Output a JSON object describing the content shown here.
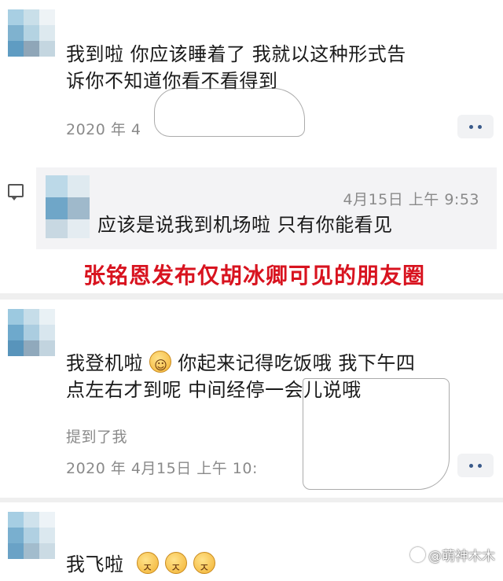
{
  "post1": {
    "text_line1": "我到啦 你应该睡着了 我就以这种形式告",
    "text_line2": "诉你不知道你看不看得到",
    "timestamp": "2020 年 4"
  },
  "comment": {
    "time": "4月15日 上午 9:53",
    "text": "应该是说我到机场啦 只有你能看见"
  },
  "caption": "张铭恩发布仅胡冰卿可见的朋友圈",
  "post2": {
    "text_line1_a": "我登机啦",
    "text_line1_b": "你起来记得吃饭哦 我下午四",
    "text_line2": "点左右才到呢 中间经停一会儿说哦",
    "mention": "提到了我",
    "timestamp": "2020 年 4月15日 上午 10:"
  },
  "post3": {
    "text": "我飞啦"
  },
  "watermark": "@萌神木木",
  "colors": {
    "caption_red": "#d8131f",
    "meta_gray": "#8a8a8a",
    "link_blue": "#3a5a8a"
  },
  "icons": [
    "more-dots-icon",
    "comment-icon",
    "grin-emoji",
    "sleep-emoji"
  ]
}
